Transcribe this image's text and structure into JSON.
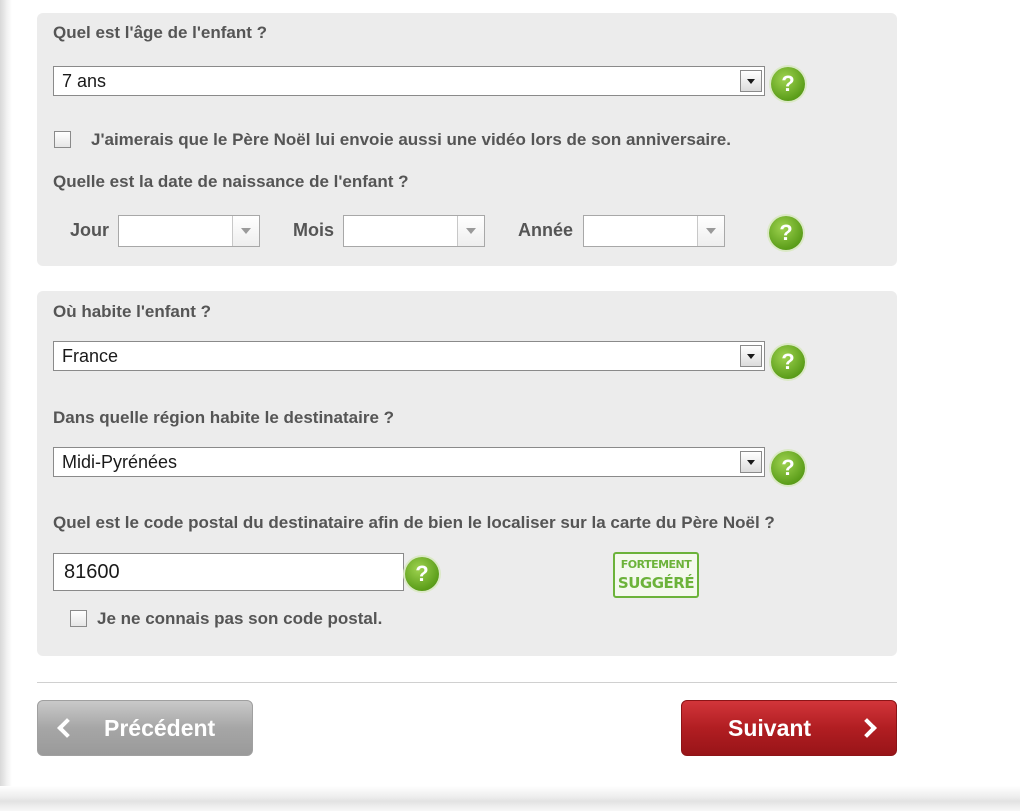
{
  "age_section": {
    "question": "Quel est l'âge de l'enfant ?",
    "age_value": "7 ans",
    "video_checkbox_label": "J'aimerais que le Père Noël lui envoie aussi une vidéo lors de son anniversaire.",
    "video_checked": false,
    "birthdate_question": "Quelle est la date de naissance de l'enfant ?",
    "day_label": "Jour",
    "day_value": "",
    "month_label": "Mois",
    "month_value": "",
    "year_label": "Année",
    "year_value": ""
  },
  "location_section": {
    "country_question": "Où habite l'enfant ?",
    "country_value": "France",
    "region_question": "Dans quelle région habite le destinataire ?",
    "region_value": "Midi-Pyrénées",
    "postal_question": "Quel est le code postal du destinataire afin de bien le localiser sur la carte du Père Noël ?",
    "postal_value": "81600",
    "badge_line1": "FORTEMENT",
    "badge_line2": "SUGGÉRÉ",
    "unknown_postal_label": "Je ne connais pas son code postal.",
    "unknown_postal_checked": false
  },
  "help_icon_text": "?",
  "nav": {
    "prev_label": "Précédent",
    "next_label": "Suivant"
  },
  "colors": {
    "card_background": "#ececec",
    "help_green": "#5c9e1a",
    "badge_green": "#6cb33a",
    "next_red": "#b11e22",
    "prev_gray": "#a6a6a6"
  },
  "icons": {
    "help": "question-mark-circle-icon",
    "prev": "chevron-left-icon",
    "next": "chevron-right-icon",
    "dropdown": "chevron-down-icon"
  }
}
